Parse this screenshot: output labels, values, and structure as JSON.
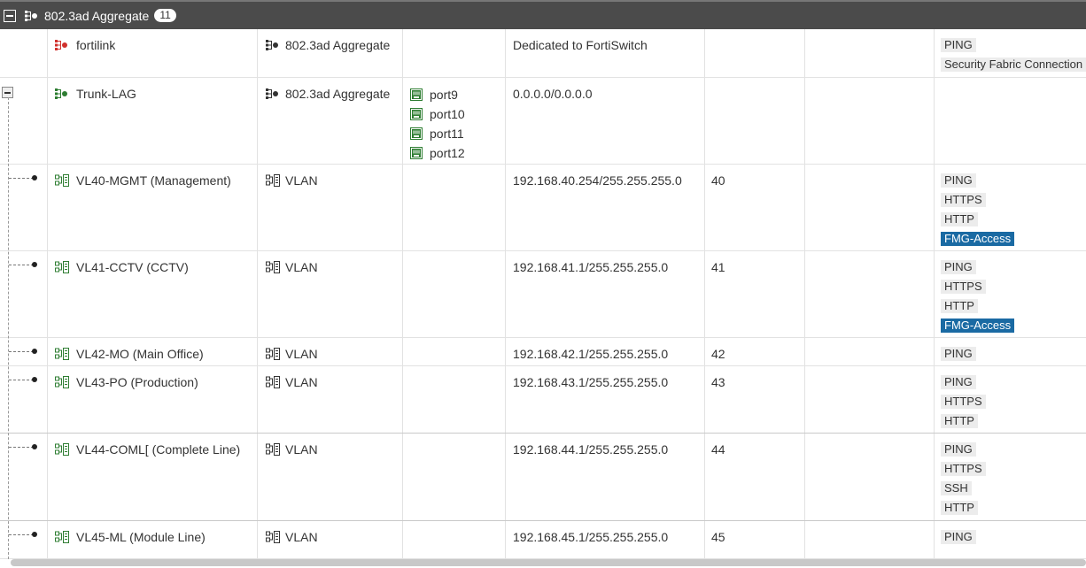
{
  "group": {
    "title": "802.3ad Aggregate",
    "count": "11"
  },
  "rows": [
    {
      "name": "fortilink",
      "name_color": "#d0312d",
      "type": "802.3ad Aggregate",
      "members": [],
      "ip": "Dedicated to FortiSwitch",
      "vlan": "",
      "access": [
        {
          "label": "PING",
          "highlight": false
        },
        {
          "label": "Security Fabric Connection",
          "highlight": false
        }
      ]
    },
    {
      "name": "Trunk-LAG",
      "name_color": "#2e7d32",
      "type": "802.3ad Aggregate",
      "members": [
        "port9",
        "port10",
        "port11",
        "port12"
      ],
      "ip": "0.0.0.0/0.0.0.0",
      "vlan": "",
      "access": []
    },
    {
      "name": "VL40-MGMT (Management)",
      "type": "VLAN",
      "members": [],
      "ip": "192.168.40.254/255.255.255.0",
      "vlan": "40",
      "access": [
        {
          "label": "PING",
          "highlight": false
        },
        {
          "label": "HTTPS",
          "highlight": false
        },
        {
          "label": "HTTP",
          "highlight": false
        },
        {
          "label": "FMG-Access",
          "highlight": true
        }
      ]
    },
    {
      "name": "VL41-CCTV (CCTV)",
      "type": "VLAN",
      "members": [],
      "ip": "192.168.41.1/255.255.255.0",
      "vlan": "41",
      "access": [
        {
          "label": "PING",
          "highlight": false
        },
        {
          "label": "HTTPS",
          "highlight": false
        },
        {
          "label": "HTTP",
          "highlight": false
        },
        {
          "label": "FMG-Access",
          "highlight": true
        }
      ]
    },
    {
      "name": "VL42-MO (Main Office)",
      "type": "VLAN",
      "members": [],
      "ip": "192.168.42.1/255.255.255.0",
      "vlan": "42",
      "access": [
        {
          "label": "PING",
          "highlight": false
        }
      ]
    },
    {
      "name": "VL43-PO (Production)",
      "type": "VLAN",
      "members": [],
      "ip": "192.168.43.1/255.255.255.0",
      "vlan": "43",
      "access": [
        {
          "label": "PING",
          "highlight": false
        },
        {
          "label": "HTTPS",
          "highlight": false
        },
        {
          "label": "HTTP",
          "highlight": false
        }
      ]
    },
    {
      "name": "VL44-COML[ (Complete Line)",
      "type": "VLAN",
      "members": [],
      "ip": "192.168.44.1/255.255.255.0",
      "vlan": "44",
      "access": [
        {
          "label": "PING",
          "highlight": false
        },
        {
          "label": "HTTPS",
          "highlight": false
        },
        {
          "label": "SSH",
          "highlight": false
        },
        {
          "label": "HTTP",
          "highlight": false
        }
      ]
    },
    {
      "name": "VL45-ML (Module Line)",
      "type": "VLAN",
      "members": [],
      "ip": "192.168.45.1/255.255.255.0",
      "vlan": "45",
      "access": [
        {
          "label": "PING",
          "highlight": false
        }
      ]
    }
  ],
  "colors": {
    "header_bg": "#4b4b4b",
    "fmg_highlight": "#1a6aa3",
    "vlan_icon": "#2e7d32",
    "port_icon": "#2e7d32"
  },
  "icons": {
    "aggregate": "aggregate-icon",
    "vlan": "vlan-icon",
    "port": "port-icon"
  }
}
